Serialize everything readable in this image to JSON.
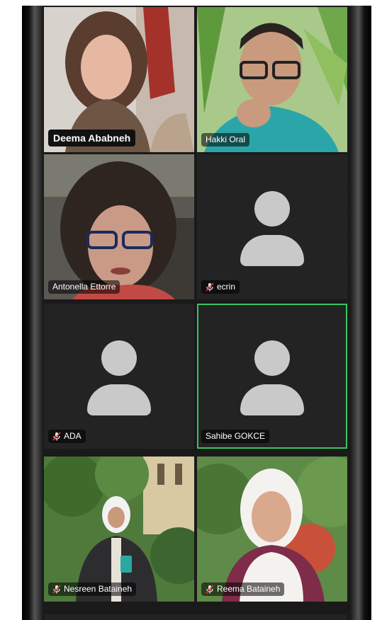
{
  "participants": [
    {
      "name": "Deema Ababneh",
      "muted": false,
      "video": true
    },
    {
      "name": "Hakki Oral",
      "muted": false,
      "video": true
    },
    {
      "name": "Antonella Ettorre",
      "muted": false,
      "video": true
    },
    {
      "name": "ecrin",
      "muted": true,
      "video": false
    },
    {
      "name": "ADA",
      "muted": true,
      "video": false
    },
    {
      "name": "Sahibe GOKCE",
      "muted": false,
      "video": false,
      "active_speaker": true
    },
    {
      "name": "Nesreen Bataineh",
      "muted": true,
      "video": true
    },
    {
      "name": "Reema Bataineh",
      "muted": true,
      "video": true
    }
  ],
  "colors": {
    "active_border": "#39c463",
    "tile_bg": "#232323",
    "avatar": "#c9c9c9"
  }
}
